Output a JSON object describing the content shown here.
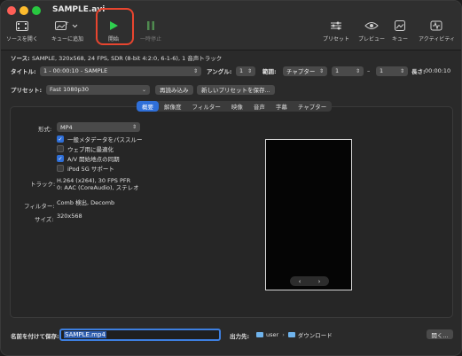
{
  "window": {
    "title": "SAMPLE.avi"
  },
  "toolbar": {
    "open_source": "ソースを開く",
    "add_to_queue": "キューに追加",
    "start": "開始",
    "pause": "一時停止",
    "presets": "プリセット",
    "preview": "プレビュー",
    "queue": "キュー",
    "activity": "アクティビティ"
  },
  "source": {
    "label": "ソース:",
    "info": "SAMPLE, 320x568, 24 FPS, SDR (8-bit 4:2:0, 6-1-6), 1 音声トラック"
  },
  "title_row": {
    "label": "タイトル:",
    "title_value": "1 - 00:00:10 - SAMPLE",
    "angle_label": "アングル:",
    "angle_value": "1",
    "range_label": "範囲:",
    "range_type": "チャプター",
    "range_start": "1",
    "range_sep": "–",
    "range_end": "1",
    "duration_label": "長さ:",
    "duration_value": "00:00:10"
  },
  "preset_row": {
    "label": "プリセット:",
    "value": "Fast 1080p30",
    "reload_button": "再読み込み",
    "save_new_button": "新しいプリセットを保存..."
  },
  "tabs": [
    "概要",
    "解像度",
    "フィルター",
    "映像",
    "音声",
    "字幕",
    "チャプター"
  ],
  "summary": {
    "format_label": "形式:",
    "format_value": "MP4",
    "opt_metadata": "一般メタデータをパススルー",
    "opt_web": "ウェブ用に最適化",
    "opt_av": "A/V 開始地点の同期",
    "opt_ipod": "iPod 5G サポート",
    "track_label": "トラック:",
    "track_line1": "H.264 (x264), 30 FPS PFR",
    "track_line2": "0: AAC (CoreAudio), ステレオ",
    "filter_label": "フィルター:",
    "filter_value": "Comb 検出, Decomb",
    "size_label": "サイズ:",
    "size_value": "320x568"
  },
  "preview_nav": {
    "prev": "‹",
    "next": "›"
  },
  "bottom": {
    "save_as_label": "名前を付けて保存:",
    "save_as_value": "SAMPLE.mp4",
    "dest_label": "出力先:",
    "dest_user": "user",
    "dest_sep": "›",
    "dest_folder": "ダウンロード",
    "browse_button": "開く..."
  },
  "colors": {
    "accent": "#2f6fd8",
    "start_green": "#2fcf4f",
    "highlight": "#e8452f"
  }
}
